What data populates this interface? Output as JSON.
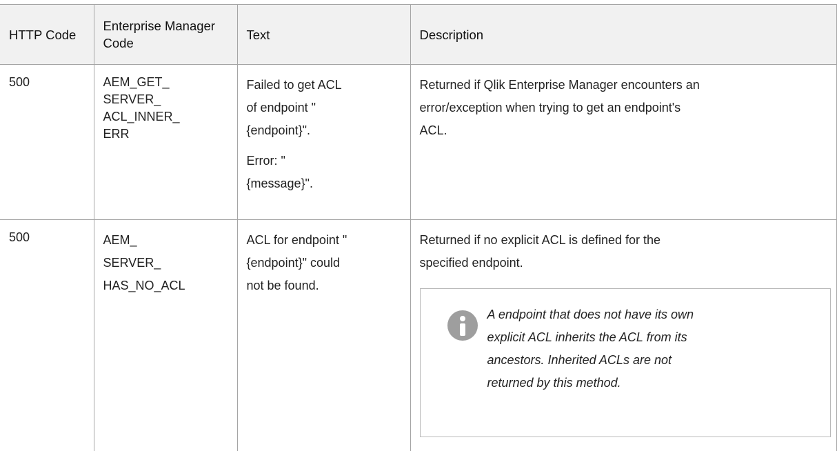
{
  "table": {
    "headers": {
      "http_code": "HTTP Code",
      "em_code": "Enterprise Manager Code",
      "text": "Text",
      "description": "Description"
    },
    "rows": [
      {
        "http_code": "500",
        "em_code_lines": [
          "AEM_GET_",
          "SERVER_",
          "ACL_INNER_",
          "ERR"
        ],
        "text_paragraphs": [
          [
            "Failed to get ACL",
            "of endpoint \"",
            "{endpoint}\"."
          ],
          [
            "Error: \"",
            "{message}\"."
          ]
        ],
        "description_lines": [
          "Returned if Qlik Enterprise Manager encounters an",
          "error/exception when trying to get an endpoint's",
          "ACL."
        ]
      },
      {
        "http_code": "500",
        "em_code_lines": [
          "AEM_",
          "SERVER_",
          "HAS_NO_ACL"
        ],
        "text_paragraphs": [
          [
            "ACL for endpoint \"",
            "{endpoint}\" could",
            "not be found."
          ]
        ],
        "description_lines": [
          "Returned if no explicit ACL is defined for the",
          "specified endpoint."
        ],
        "note": {
          "icon": "info-icon",
          "lines": [
            "A endpoint that does not have its own",
            "explicit ACL inherits the ACL from its",
            "ancestors. Inherited ACLs are not",
            "returned by this method."
          ]
        }
      }
    ]
  },
  "colors": {
    "header_bg": "#f1f1f1",
    "border": "#a5a5a5",
    "info_icon": "#9e9e9e"
  }
}
